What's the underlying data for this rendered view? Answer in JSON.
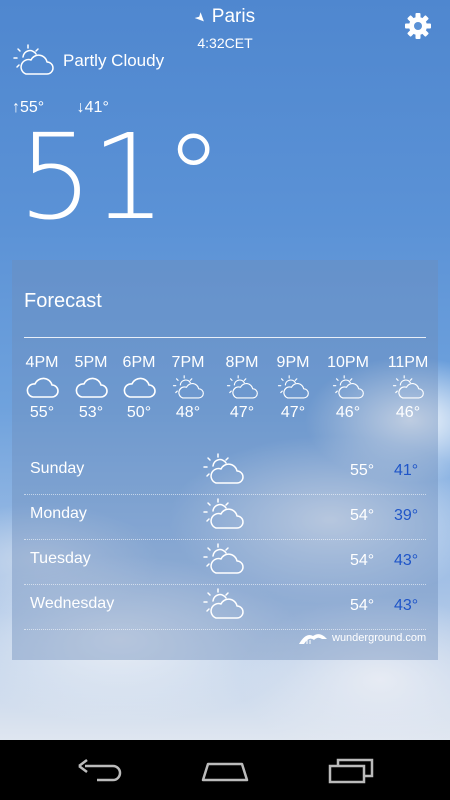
{
  "location": {
    "city": "Paris",
    "time": "4:32CET"
  },
  "current": {
    "condition": "Partly Cloudy",
    "icon": "partly-cloudy-icon",
    "high": "55°",
    "low": "41°",
    "temp": "51°"
  },
  "forecast": {
    "title": "Forecast",
    "hourly": [
      {
        "hour": "4PM",
        "temp": "55°",
        "icon": "cloud-icon"
      },
      {
        "hour": "5PM",
        "temp": "53°",
        "icon": "cloud-icon"
      },
      {
        "hour": "6PM",
        "temp": "50°",
        "icon": "cloud-icon"
      },
      {
        "hour": "7PM",
        "temp": "48°",
        "icon": "partly-cloudy-icon"
      },
      {
        "hour": "8PM",
        "temp": "47°",
        "icon": "partly-cloudy-icon"
      },
      {
        "hour": "9PM",
        "temp": "47°",
        "icon": "partly-cloudy-icon"
      },
      {
        "hour": "10PM",
        "temp": "46°",
        "icon": "partly-cloudy-icon"
      },
      {
        "hour": "11PM",
        "temp": "46°",
        "icon": "partly-cloudy-icon"
      }
    ],
    "daily": [
      {
        "day": "Sunday",
        "high": "55°",
        "low": "41°",
        "icon": "partly-cloudy-icon"
      },
      {
        "day": "Monday",
        "high": "54°",
        "low": "39°",
        "icon": "partly-cloudy-icon"
      },
      {
        "day": "Tuesday",
        "high": "54°",
        "low": "43°",
        "icon": "partly-cloudy-icon"
      },
      {
        "day": "Wednesday",
        "high": "54°",
        "low": "43°",
        "icon": "partly-cloudy-icon"
      }
    ],
    "attribution": "wunderground.com"
  },
  "colors": {
    "low_temp": "#1f55c8",
    "panel": "#6e8cb9"
  }
}
